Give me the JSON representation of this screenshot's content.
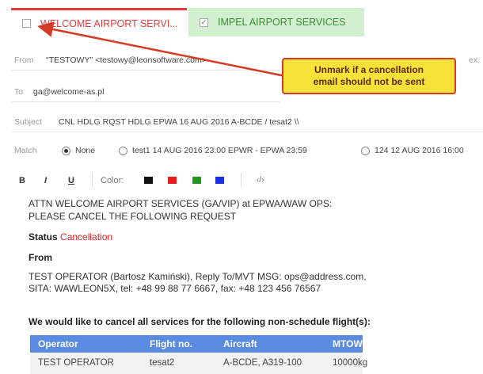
{
  "tabs": [
    {
      "label": "WELCOME AIRPORT SERVI...",
      "checked": false
    },
    {
      "label": "IMPEL AIRPORT SERVICES",
      "checked": true
    }
  ],
  "callout": {
    "line1": "Unmark if a cancellation",
    "line2": "email should not be sent"
  },
  "from": {
    "label": "From",
    "value": "\"TESTOWY\" <testowy@leonsoftware.com>",
    "extra": "ex."
  },
  "to": {
    "label": "To",
    "value": "ga@welcome-as.pl"
  },
  "subject": {
    "label": "Subject",
    "value": "CNL HDLG RQST HDLG  EPWA 16 AUG 2016  A-BCDE / tesat2 \\\\"
  },
  "match": {
    "label": "Match",
    "options": [
      {
        "label": "None",
        "selected": true
      },
      {
        "label": "test1 14 AUG 2016 23:00 EPWR - EPWA 23:59",
        "selected": false
      },
      {
        "label": "124 12 AUG 2016 16:00",
        "selected": false
      }
    ]
  },
  "toolbar": {
    "bold": "B",
    "italic": "I",
    "underline": "U",
    "color_label": "Color:",
    "colors": [
      "#111111",
      "#e41e1e",
      "#1f9a1f",
      "#1c2fe0"
    ],
    "source": "‹/›"
  },
  "body": {
    "attn_line1": "ATTN WELCOME AIRPORT SERVICES (GA/VIP) at EPWA/WAW OPS:",
    "attn_line2": "PLEASE CANCEL THE FOLLOWING REQUEST",
    "status_label": "Status",
    "status_value": "Cancellation",
    "from_heading": "From",
    "from_line1": "TEST OPERATOR (Bartosz Kamiński), Reply To/MVT MSG: ops@address.com,",
    "from_line2": "SITA: WAWLEON5X,  tel: +48 99 88 77 6667,  fax: +48 123 456 76567",
    "cancel_heading": "We would like to cancel all services for the following non-schedule flight(s):"
  },
  "table": {
    "headers": [
      "Operator",
      "Flight no.",
      "Aircraft",
      "MTOW"
    ],
    "rows": [
      [
        "TEST OPERATOR",
        "tesat2",
        "A-BCDE, A319-100",
        "10000kg"
      ]
    ]
  }
}
